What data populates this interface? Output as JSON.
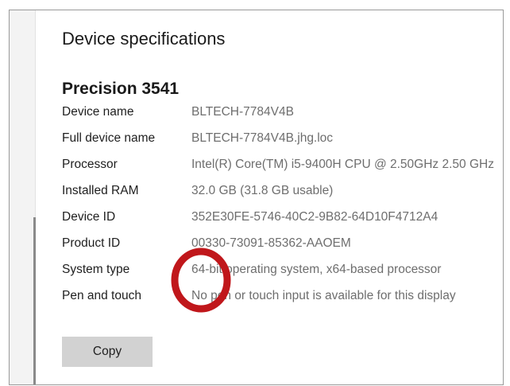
{
  "header": {
    "title": "Device specifications"
  },
  "device": {
    "model": "Precision 3541"
  },
  "specs": [
    {
      "label": "Device name",
      "value": "BLTECH-7784V4B"
    },
    {
      "label": "Full device name",
      "value": "BLTECH-7784V4B.jhg.loc"
    },
    {
      "label": "Processor",
      "value": "Intel(R) Core(TM) i5-9400H CPU @ 2.50GHz   2.50 GHz"
    },
    {
      "label": "Installed RAM",
      "value": "32.0 GB (31.8 GB usable)"
    },
    {
      "label": "Device ID",
      "value": "352E30FE-5746-40C2-9B82-64D10F4712A4"
    },
    {
      "label": "Product ID",
      "value": "00330-73091-85362-AAOEM"
    },
    {
      "label": "System type",
      "value": "64-bit operating system, x64-based processor"
    },
    {
      "label": "Pen and touch",
      "value": "No pen or touch input is available for this display"
    }
  ],
  "actions": {
    "copy_label": "Copy"
  },
  "colors": {
    "annotation": "#c0171b",
    "button_bg": "#d2d2d2",
    "value_text": "#6e6e6e"
  }
}
